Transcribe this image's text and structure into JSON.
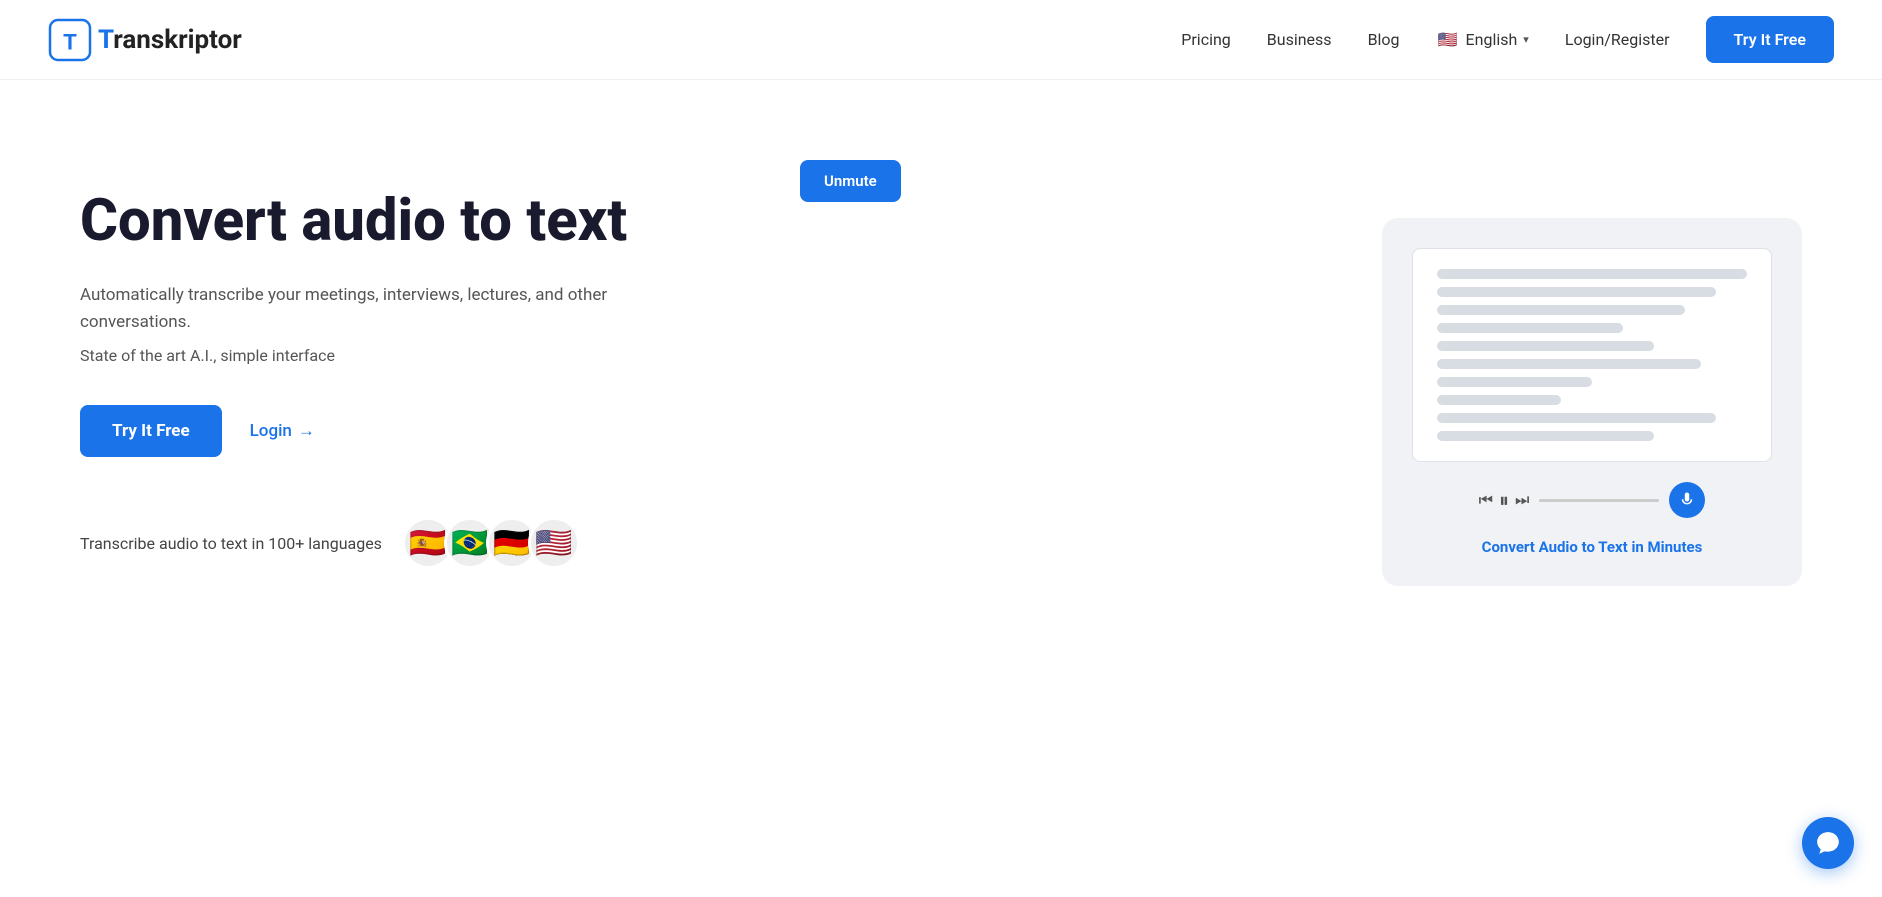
{
  "nav": {
    "logo_letter": "T",
    "logo_name_rest": "ranskriptor",
    "links": [
      {
        "id": "pricing",
        "label": "Pricing"
      },
      {
        "id": "business",
        "label": "Business"
      },
      {
        "id": "blog",
        "label": "Blog"
      }
    ],
    "lang_flag": "🇺🇸",
    "lang_label": "English",
    "login_label": "Login/Register",
    "cta_label": "Try It Free"
  },
  "hero": {
    "title": "Convert audio to text",
    "subtitle": "Automatically transcribe your meetings, interviews, lectures, and other conversations.",
    "tagline": "State of the art A.I., simple interface",
    "cta_label": "Try It Free",
    "login_label": "Login",
    "login_arrow": "→",
    "languages_text": "Transcribe audio to text in 100+ languages",
    "flags": [
      "🇪🇸",
      "🇧🇷",
      "🇩🇪",
      "🇺🇸"
    ],
    "unmute_label": "Unmute",
    "card_caption": "Convert Audio to Text in Minutes"
  },
  "mock_lines": [
    "full",
    "w90",
    "w80",
    "w60",
    "w70",
    "w85",
    "w50",
    "w40",
    "w90",
    "w70"
  ]
}
